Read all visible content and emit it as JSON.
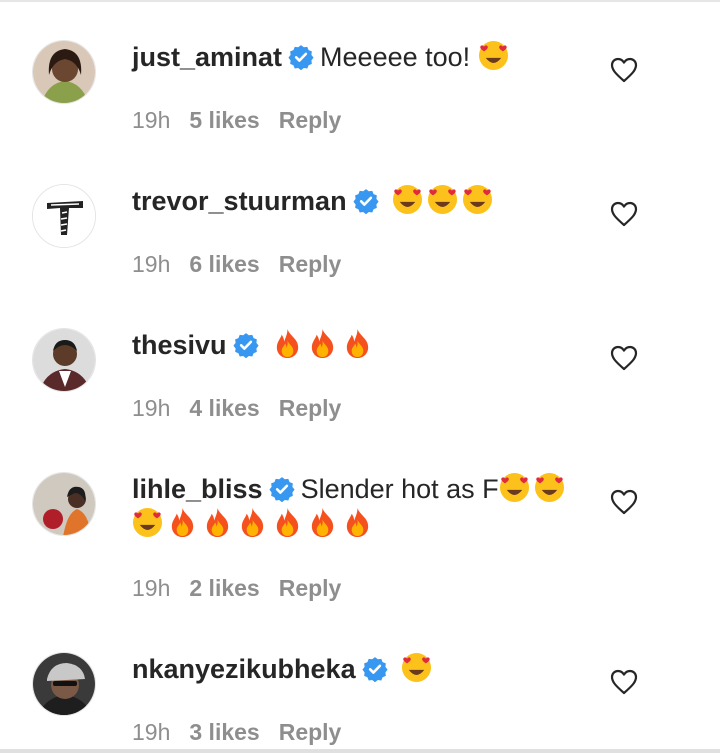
{
  "comments": [
    {
      "username": "just_aminat",
      "text": "Meeeee too!",
      "emojis_after": [
        "smiling-face-with-heart-eyes"
      ],
      "time": "19h",
      "likes": "5 likes",
      "reply": "Reply"
    },
    {
      "username": "trevor_stuurman",
      "text": "",
      "emojis_after": [
        "smiling-face-with-heart-eyes",
        "smiling-face-with-heart-eyes",
        "smiling-face-with-heart-eyes"
      ],
      "time": "19h",
      "likes": "6 likes",
      "reply": "Reply"
    },
    {
      "username": "thesivu",
      "text": "",
      "emojis_after": [
        "fire",
        "fire",
        "fire"
      ],
      "time": "19h",
      "likes": "4 likes",
      "reply": "Reply"
    },
    {
      "username": "lihle_bliss",
      "text": "Slender hot as F",
      "emojis_after": [
        "smiling-face-with-heart-eyes",
        "smiling-face-with-heart-eyes",
        "smiling-face-with-heart-eyes",
        "fire",
        "fire",
        "fire",
        "fire",
        "fire",
        "fire"
      ],
      "time": "19h",
      "likes": "2 likes",
      "reply": "Reply"
    },
    {
      "username": "nkanyezikubheka",
      "text": "",
      "emojis_after": [
        "smiling-face-with-heart-eyes"
      ],
      "time": "19h",
      "likes": "3 likes",
      "reply": "Reply"
    }
  ],
  "colors": {
    "text": "#262626",
    "meta": "#8e8e8e",
    "verified": "#3897f0"
  }
}
